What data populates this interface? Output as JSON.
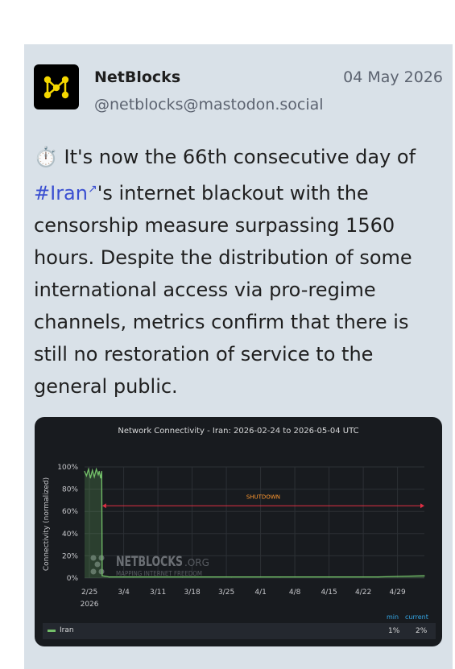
{
  "post": {
    "author_name": "NetBlocks",
    "handle": "@netblocks@mastodon.social",
    "date": "04 May 2026",
    "stopwatch_icon": "⏱️",
    "text_part1": " It's now the 66th consecutive day of ",
    "hashtag": "#Iran",
    "text_part2": "'s internet blackout with the censorship measure surpassing 1560 hours. Despite the distribution of some international access via pro-regime channels, metrics confirm that there is still no restoration of service to the general public."
  },
  "chart_data": {
    "type": "line",
    "title": "Network Connectivity - Iran: 2026-02-24 to 2026-05-04 UTC",
    "ylabel": "Connectivity (normalized)",
    "xlabel": "",
    "y_ticks": [
      "0%",
      "20%",
      "40%",
      "60%",
      "80%",
      "100%"
    ],
    "x_ticks": [
      "2/25",
      "3/4",
      "3/11",
      "3/18",
      "3/25",
      "4/1",
      "4/8",
      "4/15",
      "4/22",
      "4/29"
    ],
    "x_year_label": "2026",
    "ylim": [
      0,
      100
    ],
    "x_range_days": [
      0,
      69.5
    ],
    "series": [
      {
        "name": "Iran",
        "color": "#73bf69",
        "points": [
          [
            0,
            96
          ],
          [
            0.4,
            92
          ],
          [
            0.8,
            98
          ],
          [
            1.2,
            90
          ],
          [
            1.6,
            97
          ],
          [
            2,
            91
          ],
          [
            2.4,
            98
          ],
          [
            2.8,
            93
          ],
          [
            3.0,
            96
          ],
          [
            3.3,
            90
          ],
          [
            3.5,
            96
          ],
          [
            3.6,
            2
          ],
          [
            5,
            1
          ],
          [
            10,
            1
          ],
          [
            20,
            1
          ],
          [
            30,
            1
          ],
          [
            40,
            1
          ],
          [
            50,
            1
          ],
          [
            60,
            1
          ],
          [
            69.5,
            2
          ]
        ]
      }
    ],
    "annotation": {
      "label": "SHUTDOWN",
      "from_day": 3.6,
      "to_day": 69.5,
      "y": 65,
      "color": "#e02f44",
      "label_color": "#ff9830"
    },
    "watermark": {
      "brand": "NETBLOCKS",
      "suffix": ".ORG",
      "tagline": "MAPPING INTERNET FREEDOM"
    },
    "legend": {
      "headers": [
        "min",
        "current"
      ],
      "values": [
        "1%",
        "2%"
      ]
    },
    "grid": true,
    "legend_position": "bottom"
  }
}
